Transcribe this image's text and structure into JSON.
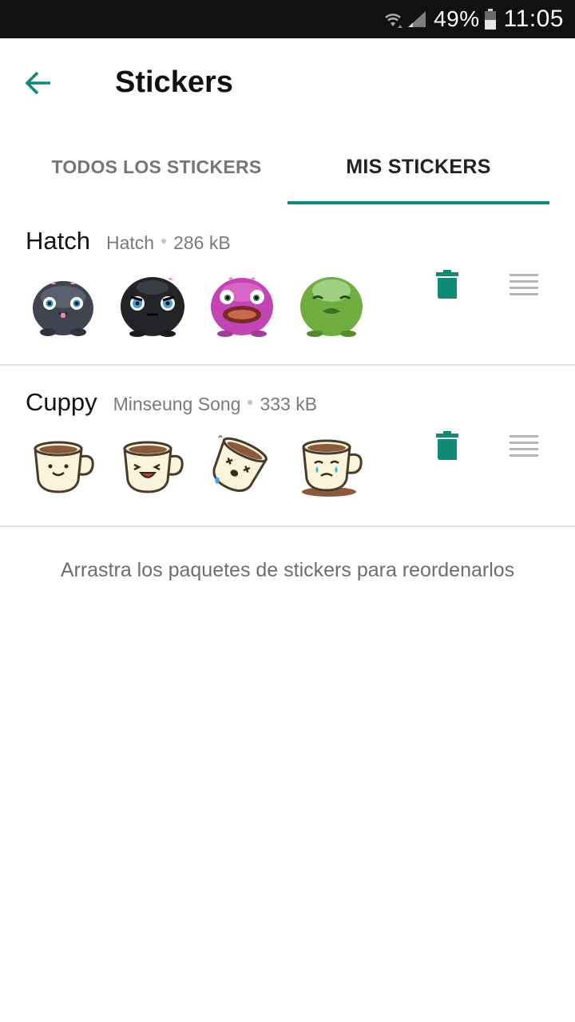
{
  "status_bar": {
    "battery_percent": "49%",
    "time": "11:05",
    "icons": [
      "wifi-icon",
      "signal-icon",
      "battery-icon"
    ]
  },
  "app_bar": {
    "title": "Stickers",
    "back_icon": "arrow-back-icon"
  },
  "tabs": [
    {
      "label": "TODOS LOS STICKERS",
      "selected": false
    },
    {
      "label": "MIS STICKERS",
      "selected": true
    }
  ],
  "packs": [
    {
      "name": "Hatch",
      "author": "Hatch",
      "size": "286 kB",
      "stickers": [
        "hatch-dark-gray",
        "hatch-black",
        "hatch-pink",
        "hatch-green"
      ]
    },
    {
      "name": "Cuppy",
      "author": "Minseung Song",
      "size": "333 kB",
      "stickers": [
        "cuppy-smile",
        "cuppy-laugh",
        "cuppy-dizzy",
        "cuppy-cry"
      ]
    }
  ],
  "hint": "Arrastra los paquetes de stickers para reordenarlos",
  "colors": {
    "accent": "#0f8a78",
    "status_bar": "#111111",
    "divider": "#e2e2e2",
    "secondary_text": "#7a7a7a"
  }
}
